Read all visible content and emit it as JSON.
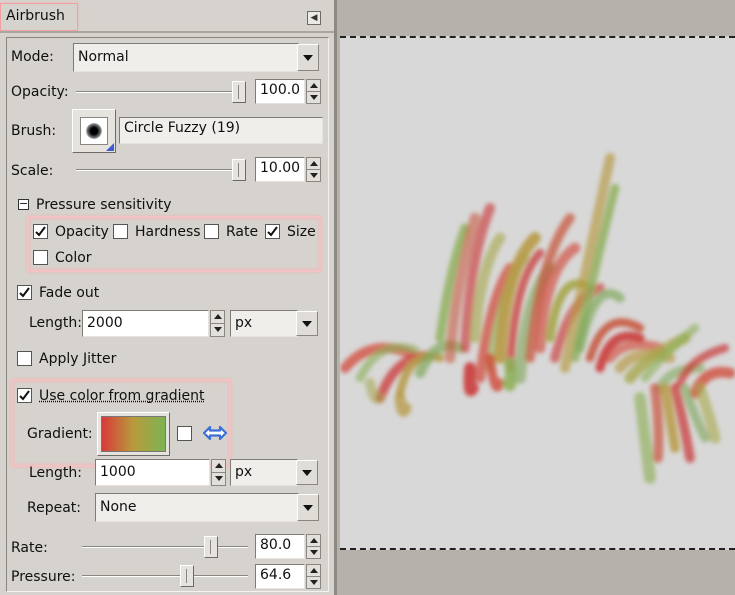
{
  "dock": {
    "tab_label": "Airbrush"
  },
  "options": {
    "mode": {
      "label": "Mode:",
      "value": "Normal"
    },
    "opacity": {
      "label": "Opacity:",
      "value": "100.0",
      "fraction": 1.0
    },
    "brush": {
      "label": "Brush:",
      "name": "Circle Fuzzy (19)"
    },
    "scale": {
      "label": "Scale:",
      "value": "10.00",
      "fraction": 1.0
    },
    "pressure_sensitivity": {
      "label": "Pressure sensitivity",
      "items": [
        {
          "label": "Opacity",
          "checked": true
        },
        {
          "label": "Hardness",
          "checked": false
        },
        {
          "label": "Rate",
          "checked": false
        },
        {
          "label": "Size",
          "checked": true
        },
        {
          "label": "Color",
          "checked": false
        }
      ]
    },
    "fade_out": {
      "label": "Fade out",
      "checked": true,
      "length_label": "Length:",
      "length_value": "2000",
      "unit": "px"
    },
    "apply_jitter": {
      "label": "Apply Jitter",
      "checked": false
    },
    "use_gradient": {
      "label": "Use color from gradient",
      "checked": true,
      "gradient_label": "Gradient:",
      "reverse_checked": false,
      "length_label": "Length:",
      "length_value": "1000",
      "unit": "px",
      "repeat_label": "Repeat:",
      "repeat_value": "None"
    },
    "rate": {
      "label": "Rate:",
      "value": "80.0",
      "fraction": 0.8
    },
    "pressure": {
      "label": "Pressure:",
      "value": "64.6",
      "fraction": 0.646
    }
  },
  "colors": {
    "panel_bg": "#d6d3ce",
    "canvas_bg": "#d8d8d8",
    "highlight": "#f3c3c3",
    "gradient_start": "#d83a3a",
    "gradient_end": "#7cb352",
    "swap_icon": "#3d6fd6"
  }
}
